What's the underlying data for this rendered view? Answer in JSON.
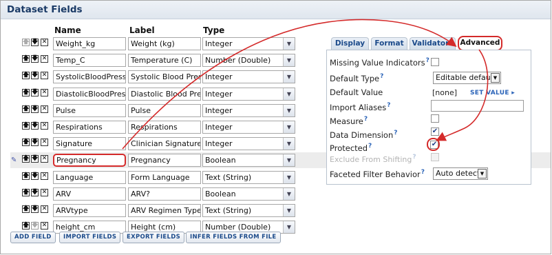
{
  "title": "Dataset Fields",
  "columns": {
    "name": "Name",
    "label": "Label",
    "type": "Type"
  },
  "fields": [
    {
      "name": "Weight_kg",
      "label": "Weight (kg)",
      "type": "Integer"
    },
    {
      "name": "Temp_C",
      "label": "Temperature (C)",
      "type": "Number (Double)"
    },
    {
      "name": "SystolicBloodPressure",
      "label": "Systolic Blood Pressure",
      "type": "Integer"
    },
    {
      "name": "DiastolicBloodPressure",
      "label": "Diastolic Blood Pressure",
      "type": "Integer"
    },
    {
      "name": "Pulse",
      "label": "Pulse",
      "type": "Integer"
    },
    {
      "name": "Respirations",
      "label": "Respirations",
      "type": "Integer"
    },
    {
      "name": "Signature",
      "label": "Clinician Signature/Date",
      "type": "Integer"
    },
    {
      "name": "Pregnancy",
      "label": "Pregnancy",
      "type": "Boolean"
    },
    {
      "name": "Language",
      "label": "Form Language",
      "type": "Text (String)"
    },
    {
      "name": "ARV",
      "label": "ARV?",
      "type": "Boolean"
    },
    {
      "name": "ARVtype",
      "label": "ARV Regimen Type",
      "type": "Text (String)"
    },
    {
      "name": "height_cm",
      "label": "Height (cm)",
      "type": "Number (Double)"
    }
  ],
  "buttons": {
    "add_field": "ADD FIELD",
    "import_fields": "IMPORT FIELDS",
    "export_fields": "EXPORT FIELDS",
    "infer_fields": "INFER FIELDS FROM FILE"
  },
  "tabs": {
    "display": "Display",
    "format": "Format",
    "validators": "Validators",
    "advanced": "Advanced"
  },
  "advanced": {
    "missing_value_indicators": {
      "label": "Missing Value Indicators",
      "checked": false
    },
    "default_type": {
      "label": "Default Type",
      "value": "Editable default"
    },
    "default_value": {
      "label": "Default Value",
      "value": "[none]",
      "link": "SET VALUE"
    },
    "import_aliases": {
      "label": "Import Aliases",
      "value": ""
    },
    "measure": {
      "label": "Measure",
      "checked": false
    },
    "data_dimension": {
      "label": "Data Dimension",
      "checked": true
    },
    "protected": {
      "label": "Protected",
      "checked": true
    },
    "exclude_from_shifting": {
      "label": "Exclude From Shifting",
      "checked": false
    },
    "faceted_filter_behavior": {
      "label": "Faceted Filter Behavior",
      "value": "Auto detect"
    }
  },
  "glyphs": {
    "help": "?",
    "up": "🡅",
    "down": "🡇",
    "delete": "✕",
    "dropdown": "▼",
    "check": "✔",
    "drag": "✎",
    "link_arrow": "▸"
  },
  "colors": {
    "annotation_red": "#d42a2a",
    "link_blue": "#2a63b8",
    "title_blue": "#1a3a66"
  }
}
